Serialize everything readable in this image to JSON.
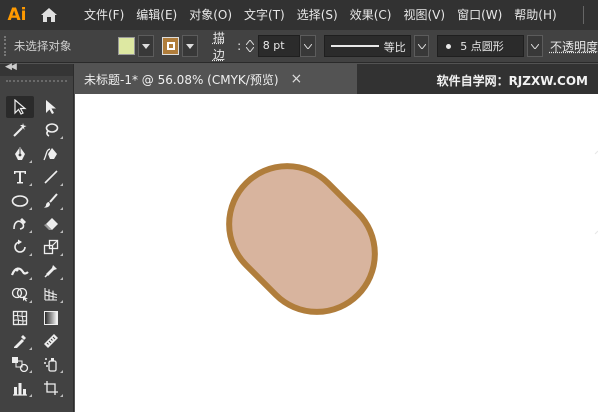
{
  "app": {
    "logo_text": "Ai"
  },
  "menu": {
    "items": [
      "文件(F)",
      "编辑(E)",
      "对象(O)",
      "文字(T)",
      "选择(S)",
      "效果(C)",
      "视图(V)",
      "窗口(W)",
      "帮助(H)"
    ]
  },
  "control_bar": {
    "selection_status": "未选择对象",
    "fill_color": "#dde8a2",
    "stroke_color": "#b07d3b",
    "stroke_label": "描边",
    "stroke_weight": "8 pt",
    "profile_label": "等比",
    "brush_label": "5 点圆形",
    "opacity_label": "不透明度"
  },
  "document": {
    "tab_title": "未标题-1* @ 56.08% (CMYK/预览)",
    "close_glyph": "×",
    "watermark": "软件自学网：RJZXW.COM"
  },
  "artwork": {
    "shape_fill": "#d8b49e",
    "shape_stroke": "#b07d3b"
  },
  "tools": [
    "selection-tool",
    "direct-selection-tool",
    "magic-wand-tool",
    "lasso-tool",
    "pen-tool",
    "curvature-tool",
    "type-tool",
    "line-segment-tool",
    "ellipse-tool",
    "paintbrush-tool",
    "shaper-tool",
    "eraser-tool",
    "rotate-tool",
    "scale-tool",
    "width-tool",
    "puppet-warp-tool",
    "shape-builder-tool",
    "perspective-grid-tool",
    "mesh-tool",
    "gradient-tool",
    "eyedropper-tool",
    "measure-tool",
    "blend-tool",
    "symbol-sprayer-tool",
    "column-graph-tool",
    "artboard-tool"
  ]
}
